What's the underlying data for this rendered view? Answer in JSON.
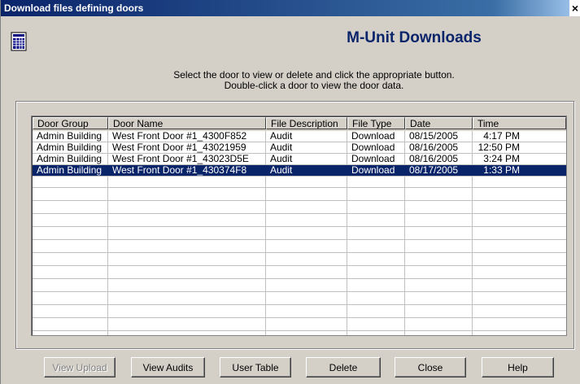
{
  "window": {
    "title": "Download files defining doors",
    "close_glyph": "×"
  },
  "heading": "M-Unit Downloads",
  "instructions": {
    "line1": "Select the door to view or delete and click the appropriate button.",
    "line2": "Double-click a door to view the door data."
  },
  "table": {
    "columns": [
      "Door Group",
      "Door Name",
      "File Description",
      "File Type",
      "Date",
      "Time"
    ],
    "rows": [
      [
        "Admin Building",
        "West Front Door #1_4300F852",
        "Audit",
        "Download",
        "08/15/2005",
        "4:17  PM"
      ],
      [
        "Admin Building",
        "West Front Door #1_43021959",
        "Audit",
        "Download",
        "08/16/2005",
        "12:50  PM"
      ],
      [
        "Admin Building",
        "West Front Door #1_43023D5E",
        "Audit",
        "Download",
        "08/16/2005",
        "3:24  PM"
      ],
      [
        "Admin Building",
        "West Front Door #1_430374F8",
        "Audit",
        "Download",
        "08/17/2005",
        "1:33  PM"
      ]
    ],
    "selected_row": 3
  },
  "buttons": {
    "view_upload": "View Upload",
    "view_audits": "View Audits",
    "user_table": "User Table",
    "delete": "Delete",
    "close": "Close",
    "help": "Help"
  },
  "colors": {
    "selection": "#0a246a",
    "heading": "#0a246a",
    "face": "#d4d0c8"
  },
  "icons": {
    "app": "spreadsheet-icon"
  }
}
